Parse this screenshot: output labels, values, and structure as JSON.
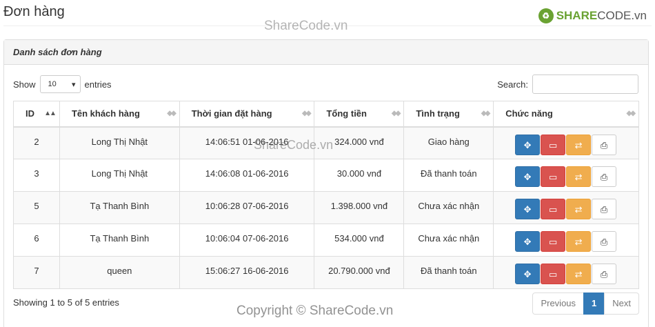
{
  "page": {
    "title": "Đơn hàng"
  },
  "logo": {
    "mark": "♻",
    "share": "SHARE",
    "code": "CODE.vn"
  },
  "watermarks": {
    "top": "ShareCode.vn",
    "middle": "ShareCode.vn",
    "bottom": "Copyright © ShareCode.vn"
  },
  "panel": {
    "heading": "Danh sách đơn hàng"
  },
  "length": {
    "show": "Show",
    "value": "10",
    "entries": "entries"
  },
  "search": {
    "label": "Search:",
    "value": ""
  },
  "table": {
    "headers": [
      "ID",
      "Tên khách hàng",
      "Thời gian đặt hàng",
      "Tổng tiền",
      "Tình trạng",
      "Chức năng"
    ],
    "sort_icon": "▲▲",
    "sort_icon_inactive": "◆◆",
    "rows": [
      {
        "id": "2",
        "customer": "Long Thị Nhật",
        "time": "14:06:51 01-06-2016",
        "total": "324.000 vnđ",
        "status": "Giao hàng"
      },
      {
        "id": "3",
        "customer": "Long Thị Nhật",
        "time": "14:06:08 01-06-2016",
        "total": "30.000 vnđ",
        "status": "Đã thanh toán"
      },
      {
        "id": "5",
        "customer": "Tạ Thanh Bình",
        "time": "10:06:28 07-06-2016",
        "total": "1.398.000 vnđ",
        "status": "Chưa xác nhận"
      },
      {
        "id": "6",
        "customer": "Tạ Thanh Bình",
        "time": "10:06:04 07-06-2016",
        "total": "534.000 vnđ",
        "status": "Chưa xác nhận"
      },
      {
        "id": "7",
        "customer": "queen",
        "time": "15:06:27 16-06-2016",
        "total": "20.790.000 vnđ",
        "status": "Đã thanh toán"
      }
    ],
    "action_icons": {
      "view": "✥",
      "card": "▭",
      "swap": "⇄",
      "print": "⎙"
    }
  },
  "footer": {
    "info": "Showing 1 to 5 of 5 entries",
    "previous": "Previous",
    "page": "1",
    "next": "Next"
  }
}
